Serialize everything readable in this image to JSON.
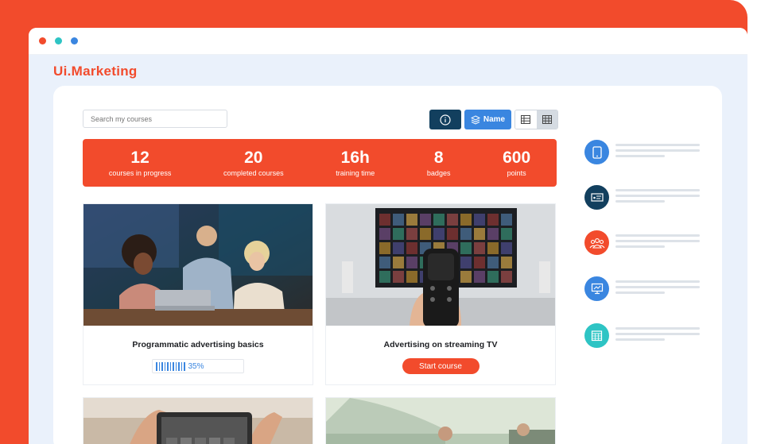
{
  "brand": "Ui.Marketing",
  "colors": {
    "accent": "#f24b2c",
    "blue": "#3a86e0",
    "navy": "#123f5e",
    "teal": "#2ec4c4",
    "page_bg": "#eaf1fb"
  },
  "window_dots": [
    "#f24b2c",
    "#2ec4c4",
    "#3a86e0"
  ],
  "search": {
    "placeholder": "Search my courses"
  },
  "toolbar": {
    "info_icon": "info-icon",
    "name_label": "Name",
    "name_icon": "layers-icon",
    "views": [
      "list-view-icon",
      "grid-view-icon"
    ],
    "active_view": "grid"
  },
  "stats": [
    {
      "value": "12",
      "label": "courses in progress"
    },
    {
      "value": "20",
      "label": "completed courses"
    },
    {
      "value": "16h",
      "label": "training time"
    },
    {
      "value": "8",
      "label": "badges"
    },
    {
      "value": "600",
      "label": "points"
    }
  ],
  "courses": [
    {
      "title": "Programmatic advertising basics",
      "progress_label": "35%",
      "progress": 0.35
    },
    {
      "title": "Advertising on streaming TV",
      "action_label": "Start course"
    }
  ],
  "sidebar": [
    {
      "icon": "tablet-icon",
      "color": "#3a86e0"
    },
    {
      "icon": "presentation-icon",
      "color": "#123f5e"
    },
    {
      "icon": "group-icon",
      "color": "#f24b2c"
    },
    {
      "icon": "screen-icon",
      "color": "#3a86e0"
    },
    {
      "icon": "calendar-icon",
      "color": "#2ec4c4"
    }
  ]
}
